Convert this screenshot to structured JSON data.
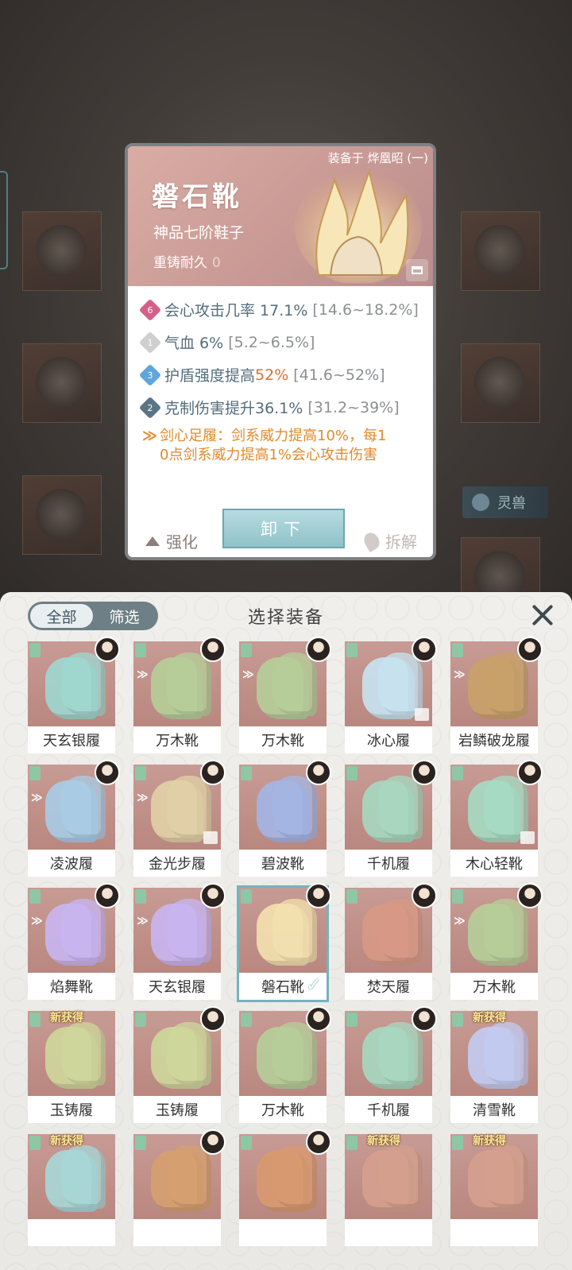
{
  "detail": {
    "equipped_on": "装备于 烨凰昭 (一)",
    "name": "磐石靴",
    "grade": "神品七阶鞋子",
    "reforge_label": "重铸耐久",
    "reforge_value": "0",
    "stats": [
      {
        "badge": "6",
        "badge_color": "#d65f8a",
        "label": "会心攻击几率 17.1%",
        "range": "[14.6~18.2%]"
      },
      {
        "badge": "1",
        "badge_color": "#cfcfcf",
        "label": "气血 6%",
        "range": "[5.2~6.5%]"
      },
      {
        "badge": "3",
        "badge_color": "#5ea6dc",
        "label_pre": "护盾强度提高 ",
        "label_hl": "52%",
        "range": "[41.6~52%]"
      },
      {
        "badge": "2",
        "badge_color": "#5c7585",
        "label": "克制伤害提升36.1%",
        "range": "[31.2~39%]"
      }
    ],
    "set_bonus_line1": "剑心足履：剑系威力提高10%，每1",
    "set_bonus_line2": "0点剑系威力提高1%会心攻击伤害",
    "enhance_label": "强化",
    "unequip_label": "卸下",
    "dismantle_label": "拆解"
  },
  "background": {
    "spirit_tag": "灵兽"
  },
  "panel": {
    "tab_all": "全部",
    "tab_filter": "筛选",
    "title": "选择装备"
  },
  "items": [
    {
      "name": "天玄银履",
      "boot": "#9fd8d0",
      "new": false,
      "selected": false,
      "lock": false,
      "set": false
    },
    {
      "name": "万木靴",
      "boot": "#b7cf9a",
      "new": false,
      "selected": false,
      "lock": false,
      "set": true
    },
    {
      "name": "万木靴",
      "boot": "#b7cf9a",
      "new": false,
      "selected": false,
      "lock": false,
      "set": true
    },
    {
      "name": "冰心履",
      "boot": "#c8e4f2",
      "new": false,
      "selected": false,
      "lock": true,
      "set": false
    },
    {
      "name": "岩鳞破龙履",
      "boot": "#c9a26a",
      "new": false,
      "selected": false,
      "lock": false,
      "set": true
    },
    {
      "name": "凌波履",
      "boot": "#a9cde6",
      "new": false,
      "selected": false,
      "lock": false,
      "set": true
    },
    {
      "name": "金光步履",
      "boot": "#e2d2a8",
      "new": false,
      "selected": false,
      "lock": true,
      "set": true
    },
    {
      "name": "碧波靴",
      "boot": "#a4b6e6",
      "new": false,
      "selected": false,
      "lock": false,
      "set": false
    },
    {
      "name": "千机履",
      "boot": "#a8d8c0",
      "new": false,
      "selected": false,
      "lock": false,
      "set": false
    },
    {
      "name": "木心轻靴",
      "boot": "#a6dcc4",
      "new": false,
      "selected": false,
      "lock": true,
      "set": false
    },
    {
      "name": "焰舞靴",
      "boot": "#c9b6f2",
      "new": false,
      "selected": false,
      "lock": false,
      "set": true
    },
    {
      "name": "天玄银履",
      "boot": "#c9b6f2",
      "new": false,
      "selected": false,
      "lock": false,
      "set": true
    },
    {
      "name": "磐石靴",
      "boot": "#f4e2b0",
      "new": false,
      "selected": true,
      "lock": false,
      "set": false
    },
    {
      "name": "焚天履",
      "boot": "#d89a86",
      "new": false,
      "selected": false,
      "lock": false,
      "set": false
    },
    {
      "name": "万木靴",
      "boot": "#b7cf9a",
      "new": false,
      "selected": false,
      "lock": false,
      "set": true
    },
    {
      "name": "玉铸履",
      "boot": "#cfd89c",
      "new": true,
      "selected": false,
      "lock": false,
      "set": false
    },
    {
      "name": "玉铸履",
      "boot": "#cfd89c",
      "new": false,
      "selected": false,
      "lock": false,
      "set": false
    },
    {
      "name": "万木靴",
      "boot": "#b7cf9a",
      "new": false,
      "selected": false,
      "lock": false,
      "set": false
    },
    {
      "name": "千机履",
      "boot": "#a8d8c0",
      "new": false,
      "selected": false,
      "lock": false,
      "set": false
    },
    {
      "name": "清雪靴",
      "boot": "#c4ccf2",
      "new": true,
      "selected": false,
      "lock": false,
      "set": false
    },
    {
      "name": "",
      "boot": "#a8d8d8",
      "new": true,
      "selected": false,
      "lock": false,
      "set": false
    },
    {
      "name": "",
      "boot": "#d6a070",
      "new": false,
      "selected": false,
      "lock": false,
      "set": false
    },
    {
      "name": "",
      "boot": "#d89a70",
      "new": false,
      "selected": false,
      "lock": false,
      "set": false
    },
    {
      "name": "",
      "boot": "#d6a08e",
      "new": true,
      "selected": false,
      "lock": false,
      "set": false
    },
    {
      "name": "",
      "boot": "#d6a08e",
      "new": true,
      "selected": false,
      "lock": false,
      "set": false
    }
  ],
  "new_tag": "新获得",
  "checkmark": "✓"
}
